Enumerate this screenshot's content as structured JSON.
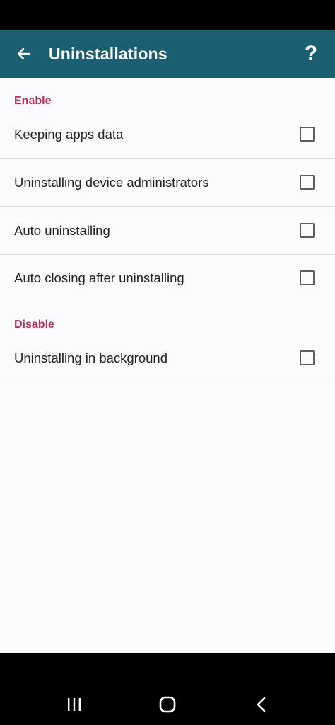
{
  "app_bar": {
    "title": "Uninstallations",
    "help_label": "?",
    "background_color": "#1b5f73"
  },
  "sections": [
    {
      "header": "Enable",
      "items": [
        {
          "label": "Keeping apps data",
          "checked": false
        },
        {
          "label": "Uninstalling device administrators",
          "checked": false
        },
        {
          "label": "Auto uninstalling",
          "checked": false
        },
        {
          "label": "Auto closing after uninstalling",
          "checked": false
        }
      ]
    },
    {
      "header": "Disable",
      "items": [
        {
          "label": "Uninstalling in background",
          "checked": false
        }
      ]
    }
  ],
  "accent_color": "#b8325a",
  "icons": {
    "back": "arrow-left-icon",
    "help": "question-mark-icon",
    "recents": "recents-icon",
    "home": "home-icon",
    "nav_back": "chevron-left-icon"
  }
}
